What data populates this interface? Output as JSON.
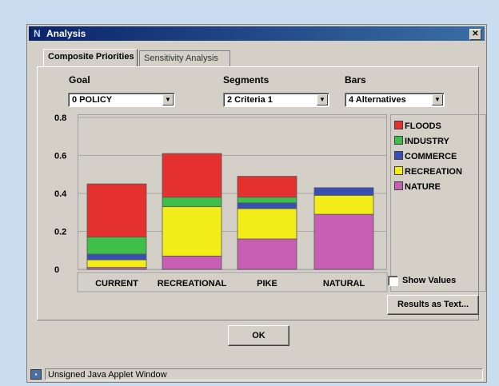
{
  "window": {
    "title": "Analysis",
    "close_label": "✕"
  },
  "tabs": [
    {
      "label": "Composite Priorities",
      "active": true
    },
    {
      "label": "Sensitivity Analysis",
      "active": false
    }
  ],
  "selectors": {
    "goal": {
      "label": "Goal",
      "value": "0 POLICY"
    },
    "segments": {
      "label": "Segments",
      "value": "2 Criteria 1"
    },
    "bars": {
      "label": "Bars",
      "value": "4 Alternatives"
    }
  },
  "chart_data": {
    "type": "bar",
    "stacked": true,
    "categories": [
      "CURRENT",
      "RECREATIONAL",
      "PIKE",
      "NATURAL"
    ],
    "series": [
      {
        "name": "NATURE",
        "color": "#c85fb4",
        "values": [
          0.01,
          0.07,
          0.16,
          0.29
        ]
      },
      {
        "name": "RECREATION",
        "color": "#f2ec18",
        "values": [
          0.04,
          0.26,
          0.16,
          0.1
        ]
      },
      {
        "name": "COMMERCE",
        "color": "#3a4fb5",
        "values": [
          0.03,
          0.0,
          0.03,
          0.04
        ]
      },
      {
        "name": "INDUSTRY",
        "color": "#3fbf4a",
        "values": [
          0.09,
          0.05,
          0.03,
          0.0
        ]
      },
      {
        "name": "FLOODS",
        "color": "#e53030",
        "values": [
          0.28,
          0.23,
          0.11,
          0.0
        ]
      }
    ],
    "yticks": [
      "0",
      "0.2",
      "0.4",
      "0.6",
      "0.8"
    ],
    "ylim": [
      0,
      0.8
    ],
    "grid": true,
    "legend_position": "right"
  },
  "legend": [
    {
      "label": "FLOODS",
      "color": "#e53030"
    },
    {
      "label": "INDUSTRY",
      "color": "#3fbf4a"
    },
    {
      "label": "COMMERCE",
      "color": "#3a4fb5"
    },
    {
      "label": "RECREATION",
      "color": "#f2ec18"
    },
    {
      "label": "NATURE",
      "color": "#c85fb4"
    }
  ],
  "show_values": {
    "label": "Show Values",
    "checked": false
  },
  "results_button": "Results as Text...",
  "ok_button": "OK",
  "status": {
    "text": "Unsigned Java Applet Window"
  }
}
